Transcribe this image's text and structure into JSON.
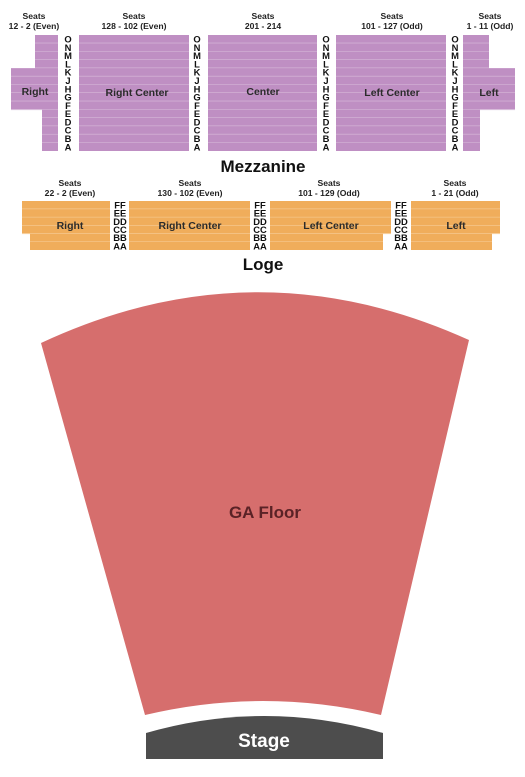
{
  "colors": {
    "mezzanine": "#bf8fc3",
    "mezzanine_divider": "#dcc2de",
    "loge": "#f0ad5b",
    "loge_divider": "#f8d3a4",
    "ga_floor": "#d66e6d",
    "stage": "#4d4d4d"
  },
  "mezzanine": {
    "title": "Mezzanine",
    "rows": [
      "O",
      "N",
      "M",
      "L",
      "K",
      "J",
      "H",
      "G",
      "F",
      "E",
      "D",
      "C",
      "B",
      "A"
    ],
    "sections": [
      {
        "id": "right",
        "label": "Right",
        "seats_title": "Seats",
        "seats_range": "12 - 2 (Even)"
      },
      {
        "id": "right-center",
        "label": "Right Center",
        "seats_title": "Seats",
        "seats_range": "128 - 102 (Even)"
      },
      {
        "id": "center",
        "label": "Center",
        "seats_title": "Seats",
        "seats_range": "201 - 214"
      },
      {
        "id": "left-center",
        "label": "Left Center",
        "seats_title": "Seats",
        "seats_range": "101 - 127 (Odd)"
      },
      {
        "id": "left",
        "label": "Left",
        "seats_title": "Seats",
        "seats_range": "1 - 11 (Odd)"
      }
    ]
  },
  "loge": {
    "title": "Loge",
    "rows": [
      "FF",
      "EE",
      "DD",
      "CC",
      "BB",
      "AA"
    ],
    "sections": [
      {
        "id": "right",
        "label": "Right",
        "seats_title": "Seats",
        "seats_range": "22 - 2 (Even)"
      },
      {
        "id": "right-center",
        "label": "Right Center",
        "seats_title": "Seats",
        "seats_range": "130 - 102 (Even)"
      },
      {
        "id": "left-center",
        "label": "Left Center",
        "seats_title": "Seats",
        "seats_range": "101 - 129 (Odd)"
      },
      {
        "id": "left",
        "label": "Left",
        "seats_title": "Seats",
        "seats_range": "1 - 21 (Odd)"
      }
    ]
  },
  "floor": {
    "label": "GA Floor"
  },
  "stage": {
    "label": "Stage"
  }
}
